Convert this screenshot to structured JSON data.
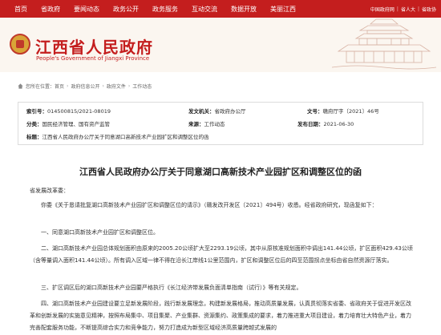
{
  "nav": {
    "items": [
      "首页",
      "省政府",
      "要闻动态",
      "政务公开",
      "政务服务",
      "互动交流",
      "数据开放",
      "美丽江西"
    ],
    "right_links": [
      "中国政府网",
      "省人大",
      "省政协"
    ]
  },
  "header": {
    "title": "江西省人民政府",
    "subtitle": "People's Government of Jiangxi Province"
  },
  "breadcrumb": {
    "label": "您所在位置：",
    "items": [
      "首页",
      "政府信息公开",
      "政府文件",
      "工作动态"
    ]
  },
  "info": {
    "index_label": "索引号：",
    "index_value": "014500815/2021-08019",
    "org_label": "发文机关：",
    "org_value": "省政府办公厅",
    "docno_label": "文号：",
    "docno_value": "赣府厅字〔2021〕46号",
    "class_label": "分类：",
    "class_value": "国民经济管理、国有资产监管",
    "source_label": "来源：",
    "source_value": "工作动态",
    "date_label": "发布日期：",
    "date_value": "2021-06-30",
    "title_label": "标题：",
    "title_value": "江西省人民政府办公厅关于同意湖口高新技术产业园扩区和调整区位的函"
  },
  "article": {
    "title": "江西省人民政府办公厅关于同意湖口高新技术产业园扩区和调整区位的函",
    "salutation": "省发展改革委：",
    "p1": "你委《关于恳请批复湖口高新技术产业园扩区和调整区位的请示》（赣发改开发区〔2021〕494号）收悉。经省政府研究，现函复如下：",
    "p2": "一、同意湖口高新技术产业园扩区和调整区位。",
    "p3": "二、湖口高新技术产业园总体规划面积由原来的2005.20公顷扩大至2293.19公顷，其中从原核准规划面积中调出141.44公顷，扩区面积429.43公顷（含等量调入面积141.44公顷）。所有调入区域一律不得在沿长江岸线1公里范围内，扩区和调整区位后的四至范围拐点坐标由省自然资源厅落实。",
    "p4": "三、扩区调区后的湖口高新技术产业园要严格执行《长江经济带发展负面清单指南（试行）》等有关规定。",
    "p5": "四、湖口高新技术产业园建设要立足新发展阶段，践行新发展理念，构建新发展格局，推动高质量发展，认真贯彻落实省委、省政府关于促进开发区改革和创新发展的实施意见精神，按照布局集中、项目集聚、产业集群、资源集约、政策集成的要求，着力推进重大项目建设，着力培育壮大特色产业，着力完善配套服务功能，不断提高综合实力和竞争能力，努力打造成为新型区域经济高质量跨越式发展的"
  }
}
